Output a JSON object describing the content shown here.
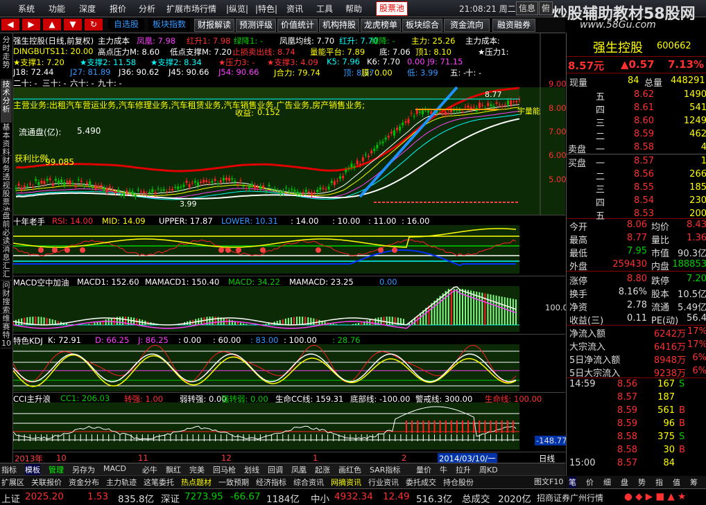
{
  "menu": [
    "系统",
    "功能",
    "深度",
    "报价",
    "分析",
    "扩展市场行情",
    "|纵览|",
    "|特色|",
    "资讯",
    "工具",
    "帮助"
  ],
  "menu_stock_btn": "股票池",
  "clock": "21:08:21 周二",
  "win_buttons": [
    "信息",
    "俯"
  ],
  "watermark": "炒股辅助教材58股网",
  "watermark_url": "www.58Gu.com",
  "toolbar": {
    "blue": [
      "自选股",
      "板块指数"
    ],
    "gray": [
      "财报解读",
      "预测评级",
      "价值统计",
      "机构持股",
      "龙虎榜单",
      "板块综合",
      "资金流向",
      "融资融券"
    ]
  },
  "left_tabs": [
    "分时走势",
    "技术分析",
    "基本资料",
    "财务透视",
    "股票池",
    "盘前必读",
    "消息汇汇",
    "问财搜索",
    "维赛特10"
  ],
  "main": {
    "title": "强生控股(日线,前复权)",
    "ind1": [
      "主力成本",
      "凤凰: 7.98",
      "红升1: 7.98",
      "绿降1: -",
      "凤凰均线: 7.70",
      "红升: 7.70",
      "绿降: -",
      "主力: 25.26",
      "主力成本:"
    ],
    "ind2": [
      "DINGBUTS11: 20.00",
      "高点压力M: 8.60",
      "低点支撑M: 7.20",
      "止损卖出线: 8.74",
      "量能平台: 7.89",
      "底: 7.06",
      "顶1: 8.10",
      "★压力1:"
    ],
    "ind3": [
      "★支撑1: 7.20",
      "★支撑2: 11.58",
      "★支撑2: 8.34",
      "★压力3: -",
      "★支撑3: 4.09",
      "K5: 7.96",
      "K6: 7.70",
      "0.00 J9: 71.15"
    ],
    "ind4": [
      "J18: 72.44",
      "J27: 81.89",
      "J36: 90.62",
      "J45: 90.66",
      "J54: 90.66",
      "J合力: 79.74",
      "顶: 8.37",
      "膜: 0.00",
      "低: 3.99",
      "五: -",
      "十: -"
    ],
    "ind5": [
      "二十: -",
      "三十: -",
      "六十: -",
      "九十: -"
    ],
    "business": "主营业务:出租汽车营运业务,汽车修理业务,汽车租赁业务,汽车销售业务,广告业务,房产销售业务;",
    "income_label": "收益:",
    "income": "0.152",
    "float_label": "流通盘(亿):",
    "float_val": "5.490",
    "profit_label": "获利比例",
    "profit_val": "99.085",
    "right_labels": [
      "9.00",
      "8.00",
      "7.00",
      "6.00",
      "5.00"
    ],
    "hi": "8.77",
    "lo": "3.99",
    "tag": "宇量能"
  },
  "p2": {
    "name": "十年老手",
    "vals": [
      "RSI: 14.00",
      "MID: 14.09",
      "UPPER: 17.87",
      "LOWER: 10.31",
      ": 14.00",
      ": 10.00",
      ": 11.00",
      ": 16.00"
    ]
  },
  "p3": {
    "name": "MACD空中加油",
    "vals": [
      "MACD1: 152.60",
      "MAMACD1: 150.40",
      "MACD: 34.22",
      "MAMACD: 23.25",
      "0.00"
    ],
    "axis": "100.0"
  },
  "p4": {
    "name": "特色KDJ",
    "vals": [
      "K: 72.91",
      "D: 66.25",
      "J: 86.25",
      ": 0.00",
      ": 60.00",
      ": 83.00",
      ": 100.00",
      ": 28.76"
    ]
  },
  "p5": {
    "name": "CCI主升浪",
    "vals": [
      "CC1: 206.03",
      "转强: 1.00",
      "弱转强: 0.00",
      "强转弱: 0.00",
      "生命CC线: 159.31",
      "底部线: -100.00",
      "警戒线: 300.00",
      "生命线: 100.00"
    ],
    "axis": "-148.77"
  },
  "timeaxis": [
    "2013年",
    "10",
    "11",
    "12",
    "1",
    "2",
    "2014/03/10/一",
    "日线"
  ],
  "btabs": [
    "指标",
    "模板",
    "管理",
    "另存为",
    "MACD",
    "必牛",
    "飘红",
    "完美",
    "回马枪",
    "划线",
    "回调",
    "凤凰",
    "起涨",
    "画红色",
    "SAR指标",
    "量价",
    "牛",
    "拉升",
    "周KD"
  ],
  "btabs2": [
    "扩展区",
    "关联报价",
    "资金分布",
    "主力轨迹",
    "这笔委托",
    "热点题材",
    "一致预期",
    "经济指标",
    "综合资讯",
    "网摘资讯",
    "行业资讯",
    "委托成交",
    "持仓股份"
  ],
  "right": {
    "name": "强生控股",
    "code": "600662",
    "price": "8.57元",
    "change": "▲0.57",
    "pct": "7.13%",
    "now_label": "现量",
    "now": "84",
    "total_label": "总量",
    "total": "448291",
    "asks": [
      [
        "五",
        "8.62",
        "1490"
      ],
      [
        "四",
        "8.61",
        "541"
      ],
      [
        "三",
        "8.60",
        "1249"
      ],
      [
        "二",
        "8.59",
        "462"
      ],
      [
        "一",
        "8.58",
        "4"
      ]
    ],
    "ask_label": "卖盘",
    "bid_label": "买盘",
    "bids": [
      [
        "一",
        "8.57",
        "1"
      ],
      [
        "二",
        "8.56",
        "266"
      ],
      [
        "三",
        "8.55",
        "185"
      ],
      [
        "四",
        "8.54",
        "230"
      ],
      [
        "五",
        "8.53",
        "200"
      ]
    ],
    "stats": [
      [
        "今开",
        "8.06",
        "均价",
        "8.43"
      ],
      [
        "最高",
        "8.77",
        "量比",
        "1.36"
      ],
      [
        "最低",
        "7.95",
        "市值",
        "90.3亿"
      ],
      [
        "外盘",
        "259430",
        "内盘",
        "188853"
      ]
    ],
    "stats2": [
      [
        "涨停",
        "8.80",
        "跌停",
        "7.20"
      ],
      [
        "换手",
        "8.16%",
        "股本",
        "10.5亿"
      ],
      [
        "净资",
        "2.78",
        "流通",
        "5.49亿"
      ],
      [
        "收益(三)",
        "0.11",
        "PE(动)",
        "56.4"
      ]
    ],
    "flows": [
      [
        "净流入额",
        "6242万",
        "17%"
      ],
      [
        "大宗流入",
        "6416万",
        "17%"
      ],
      [
        "5日净流入额",
        "8948万",
        "6%"
      ],
      [
        "5日大宗流入",
        "9238万",
        "6%"
      ]
    ],
    "ticks": [
      [
        "14:59",
        "8.56",
        "167",
        "S"
      ],
      [
        "",
        "8.57",
        "187",
        ""
      ],
      [
        "",
        "8.59",
        "561",
        "B"
      ],
      [
        "",
        "8.59",
        "96",
        "B"
      ],
      [
        "",
        "8.58",
        "375",
        "S"
      ],
      [
        "",
        "8.58",
        "30",
        "B"
      ],
      [
        "15:00",
        "8.57",
        "84",
        ""
      ]
    ],
    "rtabs": [
      "笔",
      "价",
      "细",
      "盘",
      "势",
      "指",
      "值",
      "筹"
    ],
    "tf10": "图文F10"
  },
  "status": {
    "sh_label": "上证",
    "sh": "2025.20",
    "sh_chg": "1.53",
    "sh_amt": "835.8亿",
    "sz_label": "深证",
    "sz": "7273.95",
    "sz_chg": "-66.67",
    "sz_amt": "1184亿",
    "zx_label": "中小",
    "zx": "4932.34",
    "zx_chg": "12.49",
    "zx_amt": "516.3亿",
    "total_label": "总成交",
    "total": "2020亿",
    "broker": "招商证券广州行情"
  },
  "colors": {
    "up": "#ff3030",
    "down": "#00d000",
    "yellow": "#ffff00",
    "cyan": "#00ffff",
    "magenta": "#ff40ff",
    "blue": "#3399ff"
  }
}
